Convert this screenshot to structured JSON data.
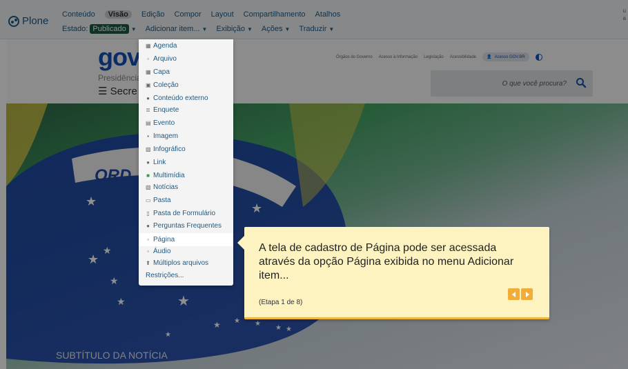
{
  "toolbar": {
    "logo_label": "Plone",
    "row1": [
      "Conteúdo",
      "Visão",
      "Edição",
      "Compor",
      "Layout",
      "Compartilhamento",
      "Atalhos"
    ],
    "row1_active": "Visão",
    "estado_label": "Estado:",
    "estado_value": "Publicado",
    "row2": [
      "Adicionar item...",
      "Exibição",
      "Ações",
      "Traduzir"
    ],
    "right_edge": [
      "u",
      "a"
    ]
  },
  "site": {
    "logo": "gov.",
    "presidencia": "Presidência",
    "secretaria": "Secre",
    "toplinks": [
      "Órgãos do Governo",
      "Acesso à Informação",
      "Legislação",
      "Acessibilidade"
    ],
    "login_label": "Acesso GOV.BR",
    "search_placeholder": "O que você procura?",
    "hero_flag_text": "ORD",
    "hero_subtitle": "SUBTÍTULO DA NOTÍCIA"
  },
  "dropdown": {
    "items": [
      "Agenda",
      "Arquivo",
      "Capa",
      "Coleção",
      "Conteúdo externo",
      "Enquete",
      "Evento",
      "Imagem",
      "Infográfico",
      "Link",
      "Multimídia",
      "Notícias",
      "Pasta",
      "Pasta de Formulário",
      "Perguntas Frequentes",
      "Página",
      "Áudio",
      "Múltiplos arquivos",
      "Restrições..."
    ],
    "highlighted": "Página"
  },
  "tooltip": {
    "text": "A tela de cadastro de Página pode ser acessada através da opção Página exibida no menu Adicionar item...",
    "step": "(Etapa 1 de 8)"
  },
  "colors": {
    "accent": "#1e5a84",
    "tooltip_bg": "#fdf3c0",
    "tooltip_btn": "#f1ad38",
    "gov_blue": "#1351b4"
  }
}
